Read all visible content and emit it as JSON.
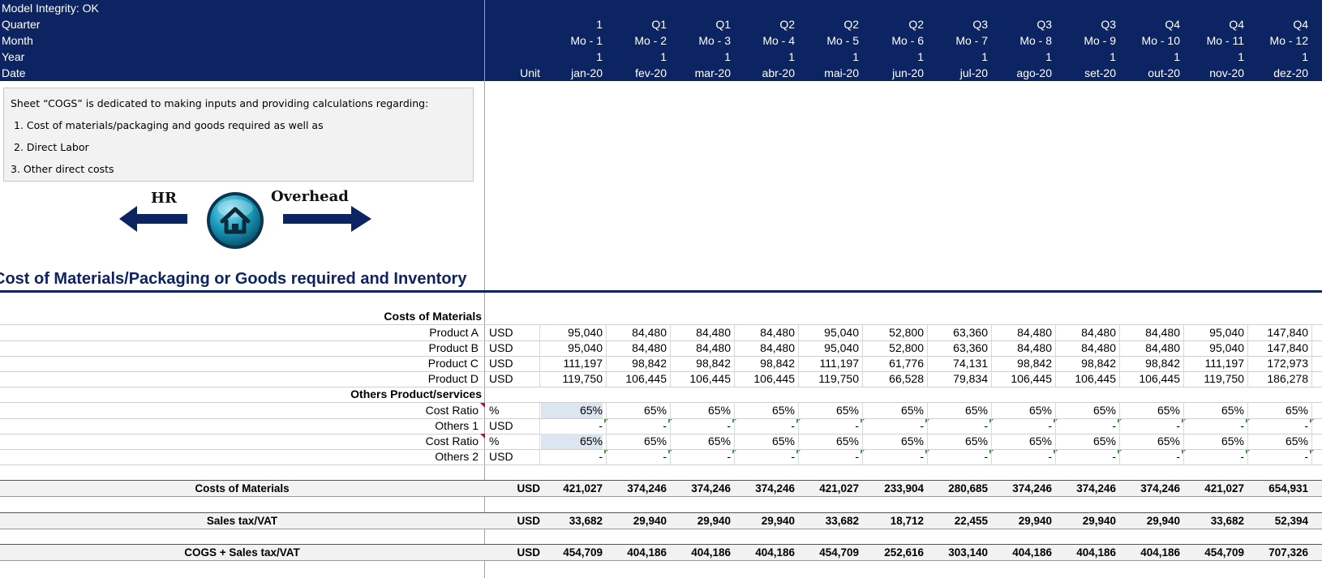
{
  "header": {
    "labels": [
      "Model Integrity: OK",
      "Quarter",
      "Month",
      "Year",
      "Date"
    ],
    "unit_label": "Unit",
    "months": [
      {
        "quarter": "1",
        "month": "Mo - 1",
        "year": "1",
        "date": "jan-20"
      },
      {
        "quarter": "Q1",
        "month": "Mo - 2",
        "year": "1",
        "date": "fev-20"
      },
      {
        "quarter": "Q1",
        "month": "Mo - 3",
        "year": "1",
        "date": "mar-20"
      },
      {
        "quarter": "Q2",
        "month": "Mo - 4",
        "year": "1",
        "date": "abr-20"
      },
      {
        "quarter": "Q2",
        "month": "Mo - 5",
        "year": "1",
        "date": "mai-20"
      },
      {
        "quarter": "Q2",
        "month": "Mo - 6",
        "year": "1",
        "date": "jun-20"
      },
      {
        "quarter": "Q3",
        "month": "Mo - 7",
        "year": "1",
        "date": "jul-20"
      },
      {
        "quarter": "Q3",
        "month": "Mo - 8",
        "year": "1",
        "date": "ago-20"
      },
      {
        "quarter": "Q3",
        "month": "Mo - 9",
        "year": "1",
        "date": "set-20"
      },
      {
        "quarter": "Q4",
        "month": "Mo - 10",
        "year": "1",
        "date": "out-20"
      },
      {
        "quarter": "Q4",
        "month": "Mo - 11",
        "year": "1",
        "date": "nov-20"
      },
      {
        "quarter": "Q4",
        "month": "Mo - 12",
        "year": "1",
        "date": "dez-20"
      }
    ]
  },
  "info": {
    "line1": "Sheet “COGS” is dedicated to making inputs and providing calculations regarding:",
    "line2": "1. Cost of materials/packaging and goods required as well as",
    "line3": "2. Direct Labor",
    "line4": "3. Other direct costs"
  },
  "nav": {
    "left_label": "HR",
    "right_label": "Overhead",
    "home_icon": "home-icon"
  },
  "section_title": "Cost of Materials/Packaging or Goods required and Inventory",
  "rows": [
    {
      "label": "Costs of Materials",
      "bold": true,
      "unit": "",
      "values": []
    },
    {
      "label": "Product A",
      "unit": "USD",
      "values": [
        "95,040",
        "84,480",
        "84,480",
        "84,480",
        "95,040",
        "52,800",
        "63,360",
        "84,480",
        "84,480",
        "84,480",
        "95,040",
        "147,840"
      ]
    },
    {
      "label": "Product B",
      "unit": "USD",
      "values": [
        "95,040",
        "84,480",
        "84,480",
        "84,480",
        "95,040",
        "52,800",
        "63,360",
        "84,480",
        "84,480",
        "84,480",
        "95,040",
        "147,840"
      ]
    },
    {
      "label": "Product C",
      "unit": "USD",
      "values": [
        "111,197",
        "98,842",
        "98,842",
        "98,842",
        "111,197",
        "61,776",
        "74,131",
        "98,842",
        "98,842",
        "98,842",
        "111,197",
        "172,973"
      ]
    },
    {
      "label": "Product D",
      "unit": "USD",
      "values": [
        "119,750",
        "106,445",
        "106,445",
        "106,445",
        "119,750",
        "66,528",
        "79,834",
        "106,445",
        "106,445",
        "106,445",
        "119,750",
        "186,278"
      ]
    },
    {
      "label": "Others Product/services",
      "bold": true,
      "unit": "",
      "values": []
    },
    {
      "label": "Cost Ratio",
      "unit": "%",
      "input": true,
      "values": [
        "65%",
        "65%",
        "65%",
        "65%",
        "65%",
        "65%",
        "65%",
        "65%",
        "65%",
        "65%",
        "65%",
        "65%"
      ]
    },
    {
      "label": "Others 1",
      "unit": "USD",
      "values": [
        "-",
        "-",
        "-",
        "-",
        "-",
        "-",
        "-",
        "-",
        "-",
        "-",
        "-",
        "-"
      ]
    },
    {
      "label": "Cost Ratio",
      "unit": "%",
      "input": true,
      "values": [
        "65%",
        "65%",
        "65%",
        "65%",
        "65%",
        "65%",
        "65%",
        "65%",
        "65%",
        "65%",
        "65%",
        "65%"
      ]
    },
    {
      "label": "Others 2",
      "unit": "USD",
      "values": [
        "-",
        "-",
        "-",
        "-",
        "-",
        "-",
        "-",
        "-",
        "-",
        "-",
        "-",
        "-"
      ]
    }
  ],
  "totals": [
    {
      "label": "Costs of Materials",
      "unit": "USD",
      "values": [
        "421,027",
        "374,246",
        "374,246",
        "374,246",
        "421,027",
        "233,904",
        "280,685",
        "374,246",
        "374,246",
        "374,246",
        "421,027",
        "654,931"
      ]
    },
    {
      "label": "Sales tax/VAT",
      "unit": "USD",
      "values": [
        "33,682",
        "29,940",
        "29,940",
        "29,940",
        "33,682",
        "18,712",
        "22,455",
        "29,940",
        "29,940",
        "29,940",
        "33,682",
        "52,394"
      ]
    },
    {
      "label": "COGS + Sales tax/VAT",
      "unit": "USD",
      "values": [
        "454,709",
        "404,186",
        "404,186",
        "404,186",
        "454,709",
        "252,616",
        "303,140",
        "404,186",
        "404,186",
        "404,186",
        "454,709",
        "707,326"
      ]
    }
  ],
  "colors": {
    "header_bg": "#0c2461",
    "input_bg": "#dce6f1",
    "total_bg": "#f2f2f2"
  }
}
